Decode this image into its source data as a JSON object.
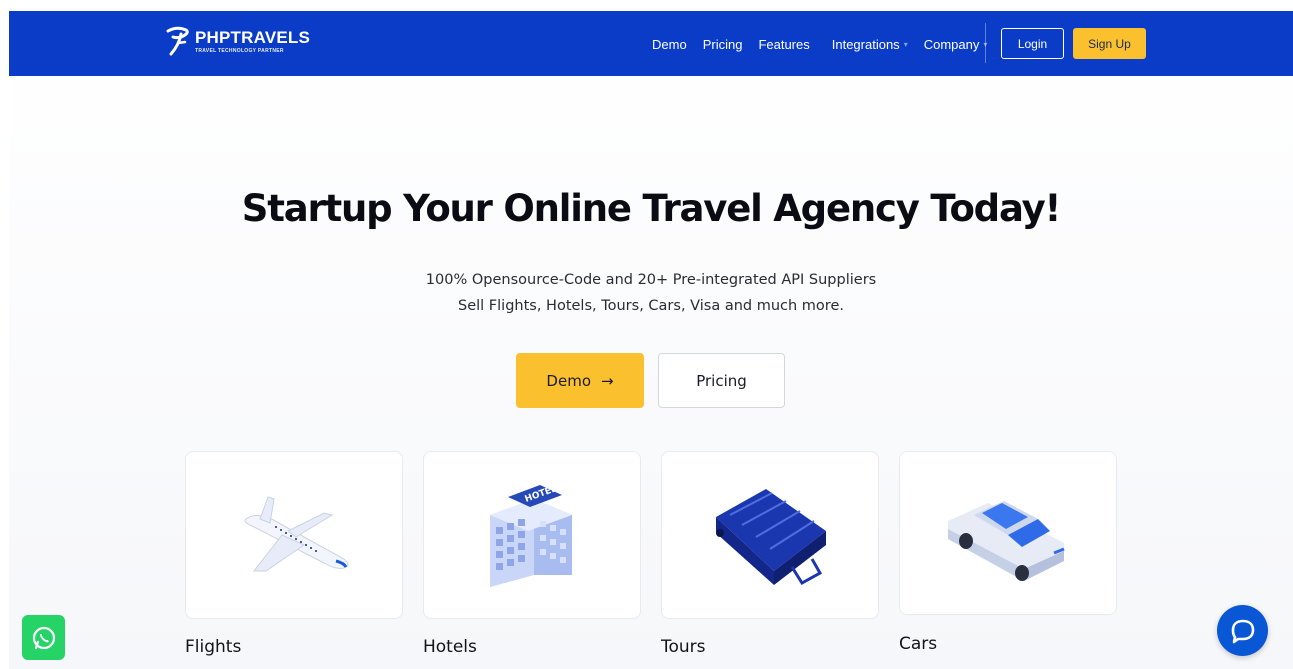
{
  "brand": {
    "name": "PHPTRAVELS",
    "tagline": "TRAVEL TECHNOLOGY PARTNER",
    "color": "#0a3cc8",
    "accent": "#fbc02d"
  },
  "nav": {
    "links": [
      {
        "label": "Demo"
      },
      {
        "label": "Pricing"
      },
      {
        "label": "Features"
      },
      {
        "label": "Integrations",
        "has_dropdown": true
      },
      {
        "label": "Company",
        "has_dropdown": true
      }
    ],
    "login_label": "Login",
    "signup_label": "Sign Up"
  },
  "hero": {
    "title": "Startup Your Online Travel Agency Today!",
    "subtitle_line1": "100% Opensource-Code and 20+ Pre-integrated API Suppliers",
    "subtitle_line2": "Sell Flights, Hotels, Tours, Cars, Visa and much more.",
    "demo_label": "Demo",
    "demo_arrow": "→",
    "pricing_label": "Pricing"
  },
  "modules": [
    {
      "label": "Flights",
      "icon": "airplane-icon"
    },
    {
      "label": "Hotels",
      "icon": "hotel-building-icon"
    },
    {
      "label": "Tours",
      "icon": "suitcase-icon"
    },
    {
      "label": "Cars",
      "icon": "car-icon"
    }
  ],
  "hotel_sign": "HOTEL",
  "widgets": {
    "whatsapp_icon": "whatsapp-icon",
    "chat_icon": "chat-bubble-icon"
  }
}
